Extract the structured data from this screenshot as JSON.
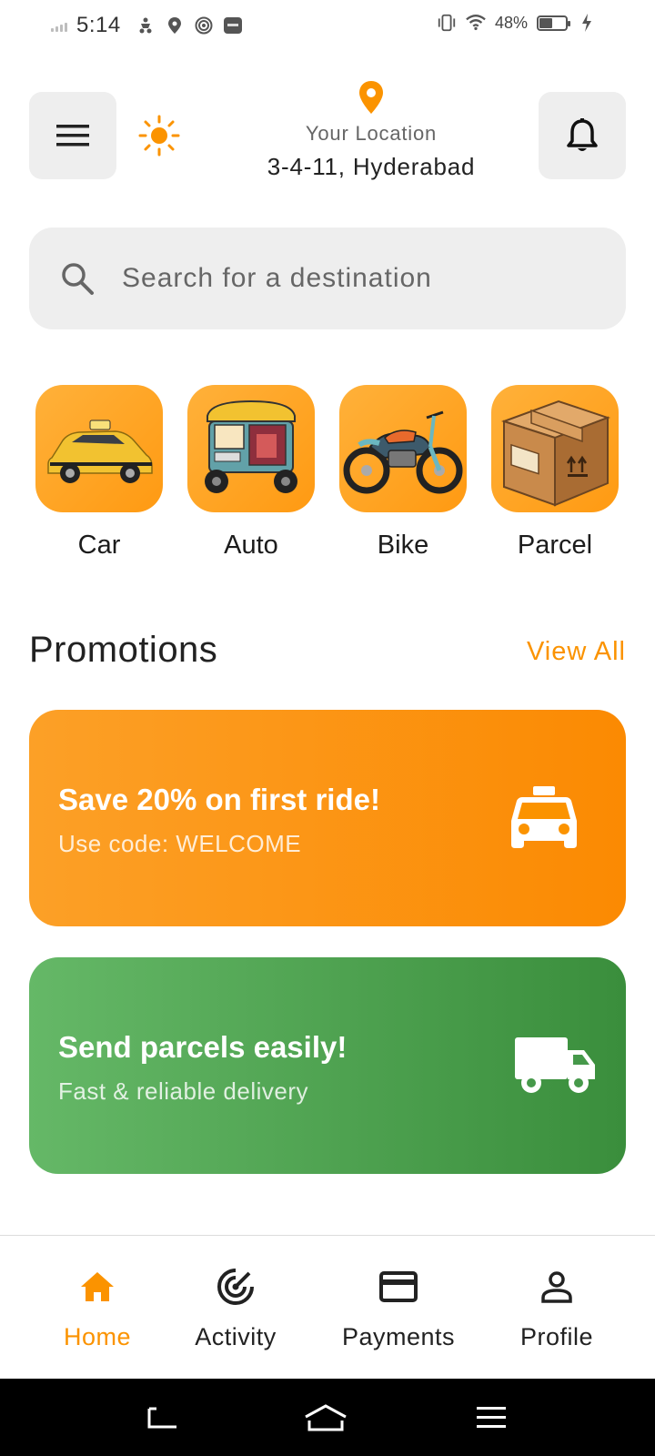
{
  "status_bar": {
    "time": "5:14",
    "battery_text": "48%",
    "battery_level": 0.48,
    "left_icons": [
      "signal-bars-icon",
      "scooter-icon",
      "map-marker-icon",
      "target-icon",
      "app-icon"
    ],
    "right_icons": [
      "vibrate-icon",
      "wifi-icon",
      "battery-icon",
      "charging-bolt-icon"
    ]
  },
  "header": {
    "location_label": "Your Location",
    "location_address": "3-4-11, Hyderabad",
    "icons": [
      "menu-icon",
      "sun-icon",
      "location-pin-icon",
      "bell-icon"
    ]
  },
  "search": {
    "placeholder": "Search for a destination",
    "value": ""
  },
  "services": [
    {
      "label": "Car",
      "icon": "taxi-car-image"
    },
    {
      "label": "Auto",
      "icon": "auto-rickshaw-image"
    },
    {
      "label": "Bike",
      "icon": "motorcycle-image"
    },
    {
      "label": "Parcel",
      "icon": "parcel-box-image"
    }
  ],
  "promotions": {
    "title": "Promotions",
    "view_all": "View All",
    "cards": [
      {
        "heading": "Save 20% on first ride!",
        "subtext": "Use code: WELCOME",
        "icon": "taxi-icon",
        "color_start": "#fca027",
        "color_end": "#fb8a02"
      },
      {
        "heading": "Send parcels easily!",
        "subtext": "Fast & reliable delivery",
        "icon": "truck-icon",
        "color_start": "#65b867",
        "color_end": "#3a8e3c"
      }
    ]
  },
  "bottom_nav": {
    "items": [
      {
        "label": "Home",
        "icon": "home-icon",
        "active": true
      },
      {
        "label": "Activity",
        "icon": "activity-icon",
        "active": false
      },
      {
        "label": "Payments",
        "icon": "card-icon",
        "active": false
      },
      {
        "label": "Profile",
        "icon": "person-icon",
        "active": false
      }
    ]
  },
  "colors": {
    "accent": "#fb9300",
    "tile_background": "#eeeeee",
    "text_primary": "#222222"
  }
}
